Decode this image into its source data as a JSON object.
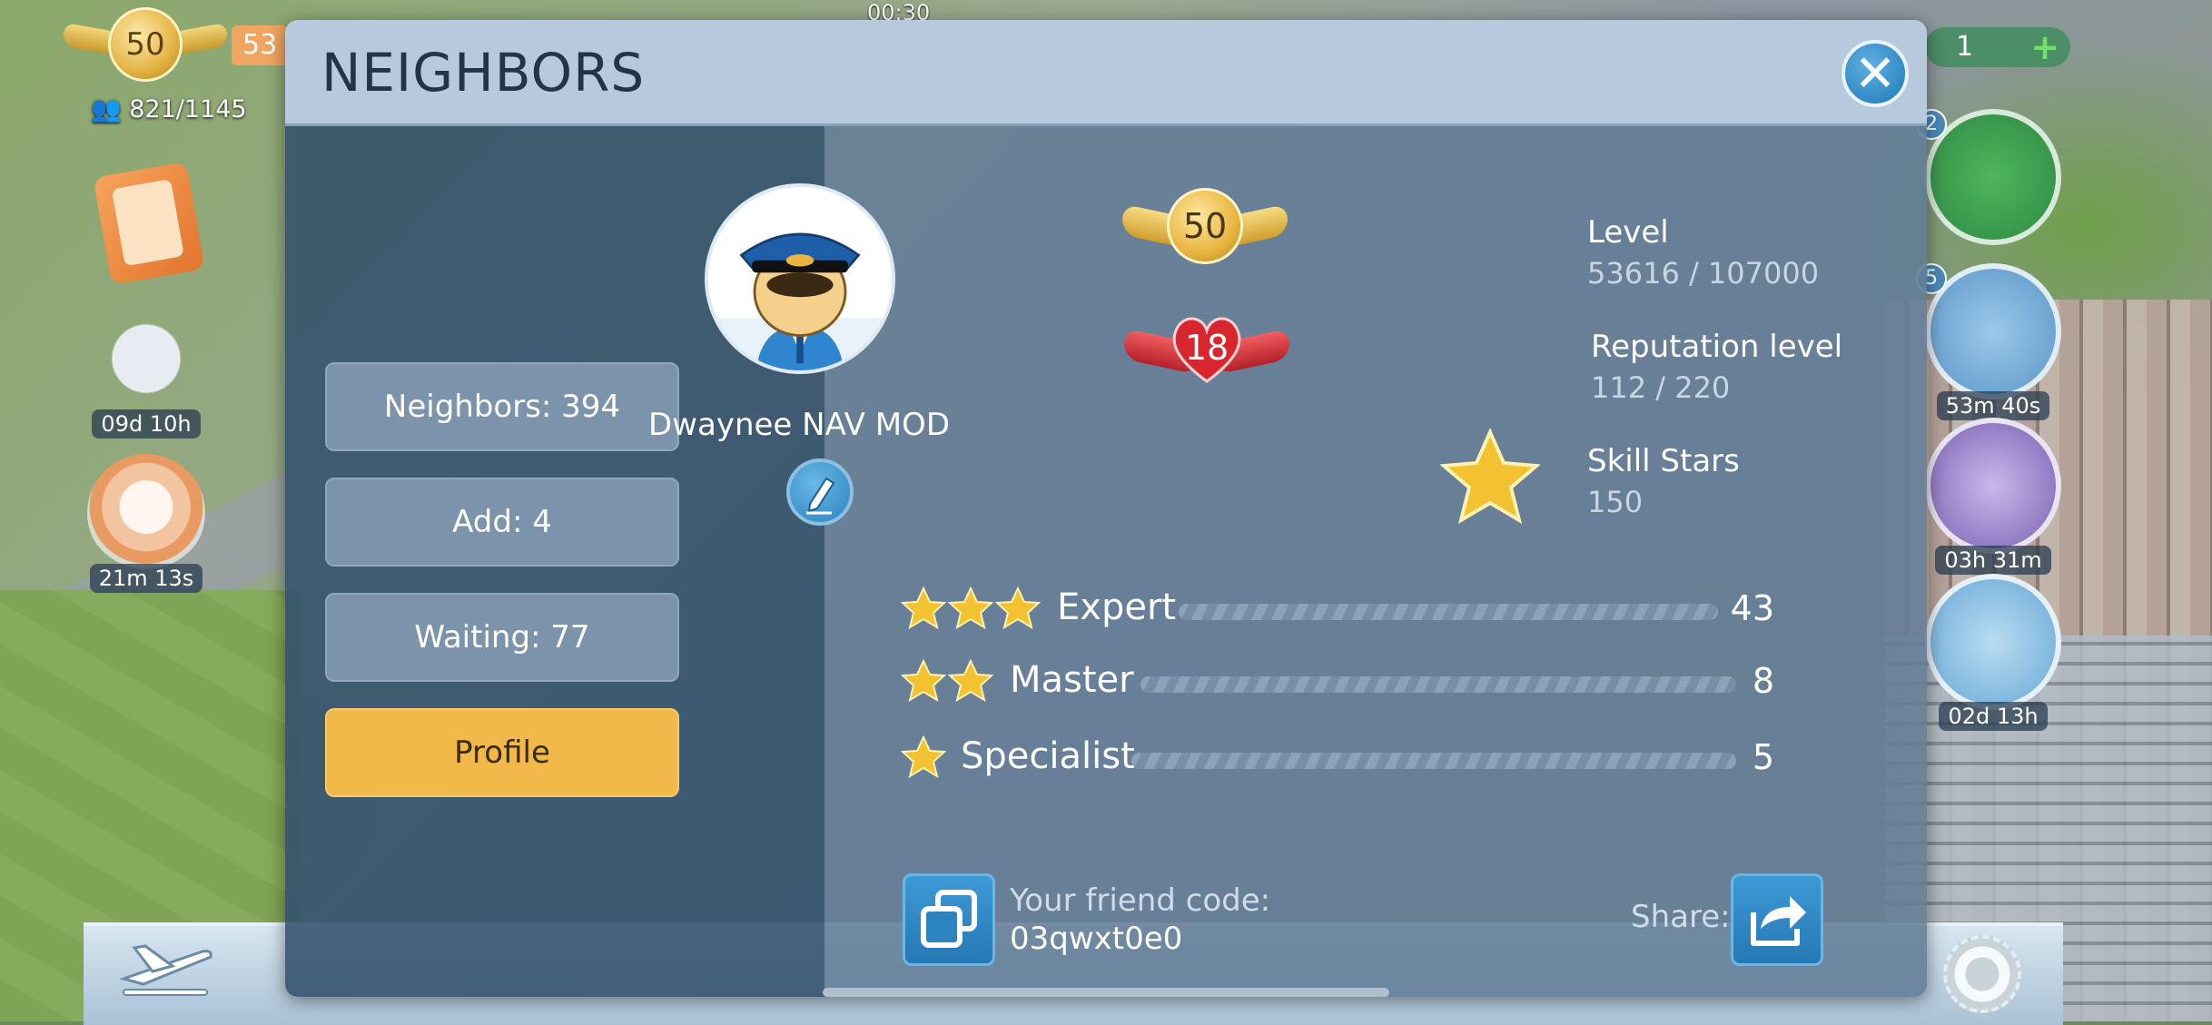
{
  "hud": {
    "player_level": "50",
    "xp_partial": "53",
    "population": "821/1145",
    "clock": "00:30",
    "left_timers": [
      "09d 10h",
      "21m 13s"
    ],
    "right_counter": "1",
    "right_timers": [
      "53m 40s",
      "03h 31m",
      "02d 13h"
    ],
    "right_badges": [
      "2",
      "5"
    ]
  },
  "dialog": {
    "title": "NEIGHBORS",
    "sidebar": [
      {
        "label": "Neighbors: 394"
      },
      {
        "label": "Add: 4"
      },
      {
        "label": "Waiting: 77"
      },
      {
        "label": "Profile",
        "active": true
      }
    ],
    "profile": {
      "name": "Dwaynee NAV MOD",
      "level": {
        "label": "Level",
        "badge": "50",
        "value": "53616 / 107000"
      },
      "reputation": {
        "label": "Reputation level",
        "badge": "18",
        "value": "112 / 220"
      },
      "skill_stars": {
        "label": "Skill Stars",
        "value": "150"
      },
      "skills": [
        {
          "stars": 3,
          "label": "Expert",
          "count": "43"
        },
        {
          "stars": 2,
          "label": "Master",
          "count": "8"
        },
        {
          "stars": 1,
          "label": "Specialist",
          "count": "5"
        }
      ],
      "friend_code_label": "Your friend code:",
      "friend_code": "03qwxt0e0",
      "share_label": "Share:"
    }
  },
  "colors": {
    "accent": "#f1b949",
    "button_blue": "#2b83c0",
    "panel_dark": "#32506c",
    "header": "#b7c9dc"
  },
  "icons": [
    "close-icon",
    "edit-pencil-icon",
    "copy-icon",
    "share-icon",
    "star-icon",
    "gear-icon",
    "plane-icon",
    "pilot-avatar"
  ]
}
